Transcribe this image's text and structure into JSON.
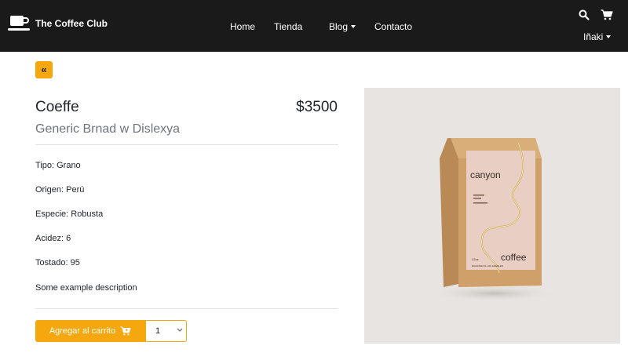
{
  "navbar": {
    "brand": "The Coffee Club",
    "links": [
      "Home",
      "Tienda",
      "Blog",
      "Contacto"
    ],
    "user": "Iñaki"
  },
  "back_button": {
    "label": "«"
  },
  "product": {
    "name": "Coeffe",
    "price": "$3500",
    "brand": "Generic Brnad w Dislexya",
    "details": [
      "Tipo: Grano",
      "Origen: Perú",
      "Especie: Robusta",
      "Acidez: 6",
      "Tostado: 95",
      "Some example description"
    ],
    "image_text": {
      "brand_top": "canyon",
      "brand_bottom": "coffee",
      "footer": "ROASTED IN LOS ANGELES",
      "weight": "12oz"
    }
  },
  "cart": {
    "add_label": "Agregar al carrito",
    "quantity": "1"
  },
  "colors": {
    "navbar": "#1a1a1a",
    "accent": "#f5a70e",
    "muted": "#6c757d"
  }
}
